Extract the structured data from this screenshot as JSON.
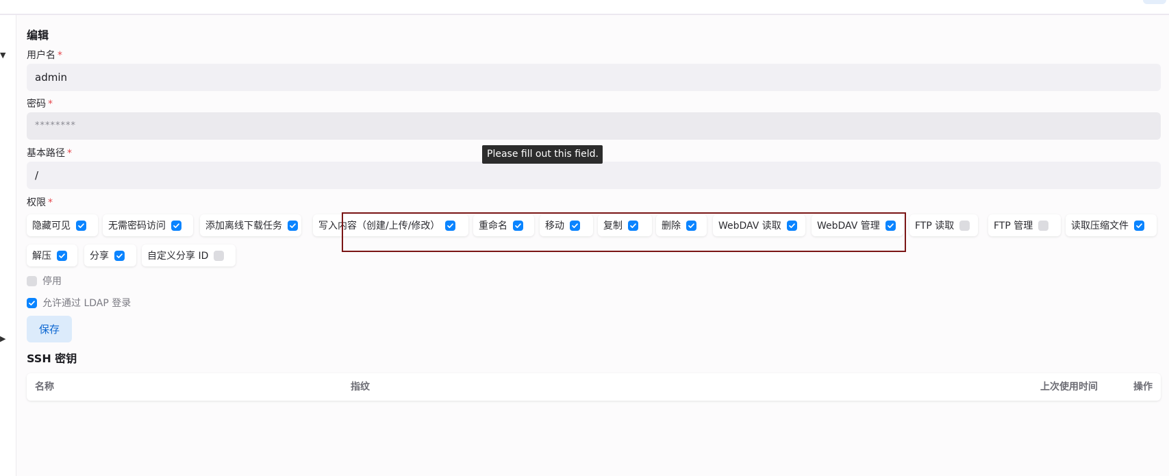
{
  "form": {
    "title": "编辑",
    "required_mark": "*",
    "username": {
      "label": "用户名",
      "value": "admin"
    },
    "password": {
      "label": "密码",
      "value": "********"
    },
    "base_path": {
      "label": "基本路径",
      "value": "/"
    },
    "tooltip": "Please fill out this field.",
    "permissions_label": "权限",
    "permissions": [
      {
        "label": "隐藏可见",
        "checked": true
      },
      {
        "label": "无需密码访问",
        "checked": true
      },
      {
        "label": "添加离线下载任务",
        "checked": true
      },
      {
        "label": "写入内容（创建/上传/修改）",
        "checked": true
      },
      {
        "label": "重命名",
        "checked": true
      },
      {
        "label": "移动",
        "checked": true
      },
      {
        "label": "复制",
        "checked": true
      },
      {
        "label": "删除",
        "checked": true
      },
      {
        "label": "WebDAV 读取",
        "checked": true
      },
      {
        "label": "WebDAV 管理",
        "checked": true
      },
      {
        "label": "FTP 读取",
        "checked": false
      },
      {
        "label": "FTP 管理",
        "checked": false
      },
      {
        "label": "读取压缩文件",
        "checked": true
      },
      {
        "label": "解压",
        "checked": true
      },
      {
        "label": "分享",
        "checked": true
      },
      {
        "label": "自定义分享 ID",
        "checked": false
      }
    ],
    "disabled": {
      "label": "停用",
      "checked": false
    },
    "allow_ldap": {
      "label": "允许通过 LDAP 登录",
      "checked": true
    },
    "save_label": "保存"
  },
  "ssh": {
    "title": "SSH 密钥",
    "columns": [
      "名称",
      "指纹",
      "上次使用时间",
      "操作"
    ]
  },
  "colors": {
    "accent": "#0a84ff",
    "required": "#e5484d",
    "highlight_box": "#7a1515"
  }
}
